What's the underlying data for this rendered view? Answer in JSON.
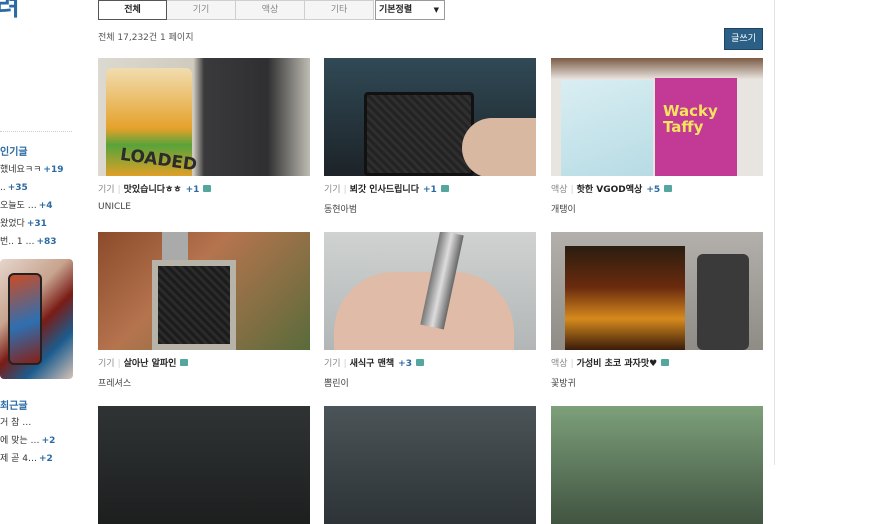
{
  "sidebar": {
    "logo_fragment": "려",
    "section1_title": "인기글",
    "popular": [
      {
        "text": "했네요ㅋㅋ",
        "count": "+19"
      },
      {
        "text": "..",
        "count": "+35"
      },
      {
        "text": "오늘도 …",
        "count": "+4"
      },
      {
        "text": "왔었다",
        "count": "+31"
      },
      {
        "text": "번.. 1 …",
        "count": "+83"
      }
    ],
    "section2_title": "최근글",
    "recent": [
      {
        "text": "거 참 …",
        "count": ""
      },
      {
        "text": "에 맞는 …",
        "count": "+2"
      },
      {
        "text": "제 곧 4…",
        "count": "+2"
      }
    ]
  },
  "tabs": [
    "전체",
    "기기",
    "액상",
    "기타"
  ],
  "active_tab": 0,
  "sort": {
    "selected": "기본정렬"
  },
  "summary": "전체 17,232건 1 페이지",
  "write_button": "글쓰기",
  "posts": [
    {
      "category": "기기",
      "title": "맛있습니다ㅎㅎ",
      "comments": "+1",
      "author": "UNICLE"
    },
    {
      "category": "기기",
      "title": "뵈갓 인사드립니다",
      "comments": "+1",
      "author": "동현아범"
    },
    {
      "category": "액상",
      "title": "핫한 VGOD액상",
      "comments": "+5",
      "author": "개탱이"
    },
    {
      "category": "기기",
      "title": "살아난 알파인",
      "comments": "",
      "author": "프레셔스"
    },
    {
      "category": "기기",
      "title": "새식구 맨책",
      "comments": "+3",
      "author": "뽐린이"
    },
    {
      "category": "액상",
      "title": "가성비 초코 과자맛♥",
      "comments": "",
      "author": "꽃방귀"
    },
    {
      "category": "",
      "title": "",
      "comments": "",
      "author": ""
    },
    {
      "category": "",
      "title": "",
      "comments": "",
      "author": ""
    },
    {
      "category": "",
      "title": "",
      "comments": "",
      "author": ""
    }
  ],
  "thumb_text": {
    "p1_label": "LOADED",
    "p3_label": "Wacky Taffy"
  },
  "colors": {
    "accent": "#2c6aa3",
    "button_bg": "#2b5f86",
    "chat_icon": "#56a6a0"
  }
}
